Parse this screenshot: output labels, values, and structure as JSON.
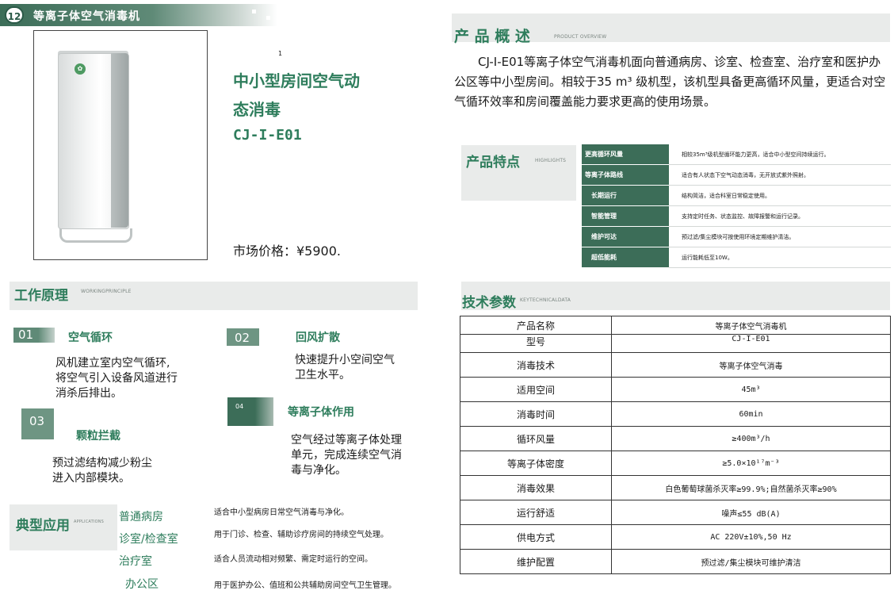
{
  "header": {
    "badge": "12",
    "title": "等离子体空气消毒机"
  },
  "product": {
    "image_footnote": "1",
    "title_line1": "中小型房间空气动",
    "title_line2": "态消毒",
    "model": "CJ-I-E01",
    "price": "市场价格：¥5900."
  },
  "principle": {
    "title": "工作原理",
    "subtitle": "WORKINGPRINCIPLE",
    "steps": [
      {
        "num": "01",
        "title": "空气循环",
        "desc": [
          "风机建立室内空气循环,",
          "将空气引入设备风道进行",
          "消杀后排出。"
        ]
      },
      {
        "num": "02",
        "title": "回风扩散",
        "desc": [
          "快速提升小空间空气",
          "卫生水平。"
        ]
      },
      {
        "num": "03",
        "title": "颗粒拦截",
        "desc": [
          "预过滤结构减少粉尘",
          "进入内部模块。"
        ]
      },
      {
        "num": "04",
        "title": "等离子体作用",
        "desc": [
          "空气经过等离子体处理",
          "单元，完成连续空气消",
          "毒与净化。"
        ]
      }
    ]
  },
  "applications": {
    "title": "典型应用",
    "subtitle": "APPLICATIONS",
    "items": [
      {
        "name": "普通病房",
        "desc": "适合中小型病房日常空气消毒与净化。"
      },
      {
        "name": "诊室/检查室",
        "desc": "用于门诊、检查、辅助诊疗房间的持续空气处理。"
      },
      {
        "name": "治疗室",
        "desc": "适合人员流动相对频繁、需定时运行的空间。"
      },
      {
        "name": "办公区",
        "desc": "用于医护办公、值班和公共辅助房间空气卫生管理。"
      }
    ]
  },
  "overview": {
    "title": "产 品 概 述",
    "subtitle": "PRODUCT OVERVIEW",
    "text": "CJ-I-E01等离子体空气消毒机面向普通病房、诊室、检查室、治疗室和医护办公区等中小型房间。相较于35 m³ 级机型，该机型具备更高循环风量，更适合对空气循环效率和房间覆盖能力要求更高的使用场景。"
  },
  "highlights": {
    "title": "产品特点",
    "subtitle": "HIGHLIGHTS",
    "rows": [
      {
        "k": "更高循环风量",
        "v": "相较35m³级机型循环能力更高，适合中小型空间持续运行。"
      },
      {
        "k": "等离子体路线",
        "v": "适合有人状态下空气动态消毒，无开放式紫外照射。"
      },
      {
        "k": "长期运行",
        "v": "结构简洁，适合科室日常稳定使用。"
      },
      {
        "k": "智能管理",
        "v": "支持定时任务、状态监控、故障报警和运行记录。"
      },
      {
        "k": "维护可达",
        "v": "预过滤/集尘模块可按使用环境定期维护清洁。"
      },
      {
        "k": "超低能耗",
        "v": "运行能耗低至10W。"
      }
    ]
  },
  "tech": {
    "title": "技术参数",
    "subtitle": "KEYTECHNICALDATA",
    "rows": [
      {
        "k": "产品名称",
        "v": "等离子体空气消毒机"
      },
      {
        "k": "型号",
        "v": "CJ-I-E01"
      },
      {
        "k": "消毒技术",
        "v": "等离子体空气消毒"
      },
      {
        "k": "适用空间",
        "v": "45m³"
      },
      {
        "k": "消毒时间",
        "v": "60min"
      },
      {
        "k": "循环风量",
        "v": "≥400m³/h"
      },
      {
        "k": "等离子体密度",
        "v": "≥5.0×10¹⁷m⁻³"
      },
      {
        "k": "消毒效果",
        "v": "白色葡萄球菌杀灭率≥99.9%;自然菌杀灭率≥90%"
      },
      {
        "k": "运行舒适",
        "v": "噪声≤55 dB(A)"
      },
      {
        "k": "供电方式",
        "v": "AC 220V±10%,50 Hz"
      },
      {
        "k": "维护配置",
        "v": "预过滤/集尘模块可维护清洁"
      }
    ]
  }
}
